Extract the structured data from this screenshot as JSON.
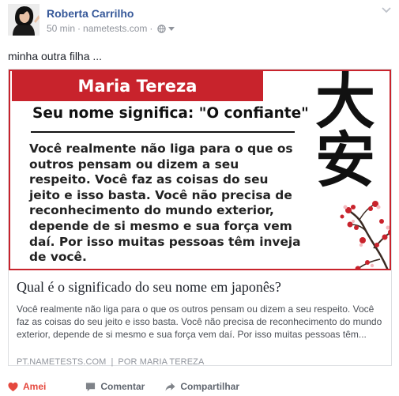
{
  "post": {
    "author": "Roberta Carrilho",
    "time": "50 min",
    "source": "nametests.com",
    "separator": "·",
    "status_text": "minha outra filha ...",
    "privacy_icon": "globe-icon",
    "menu_icon": "chevron-down-icon"
  },
  "image": {
    "banner": "Maria Tereza",
    "subtitle": "Seu nome significa: \"O confiante\"",
    "quote": "Você realmente não liga para o que os outros pensam ou dizem a seu respeito. Você faz as coisas do seu jeito e isso basta. Você não precisa de reconhecimento do mundo exterior, depende de si mesmo e sua força vem daí. Por isso muitas pessoas têm inveja de você.",
    "kanji_1": "大",
    "kanji_2": "安"
  },
  "link": {
    "title": "Qual é o significado do seu nome em japonês?",
    "description": "Você realmente não liga para o que os outros pensam ou dizem a seu respeito. Você faz as coisas do seu jeito e isso basta. Você não precisa de reconhecimento do mundo exterior, depende de si mesmo e sua força vem daí. Por isso muitas pessoas têm...",
    "domain": "PT.NAMETESTS.COM",
    "divider": "|",
    "byline": "POR MARIA TEREZA"
  },
  "actions": {
    "like": "Amei",
    "comment": "Comentar",
    "share": "Compartilhar"
  },
  "colors": {
    "accent_red": "#c8232c",
    "author_blue": "#365899",
    "love_red": "#e5483e"
  }
}
